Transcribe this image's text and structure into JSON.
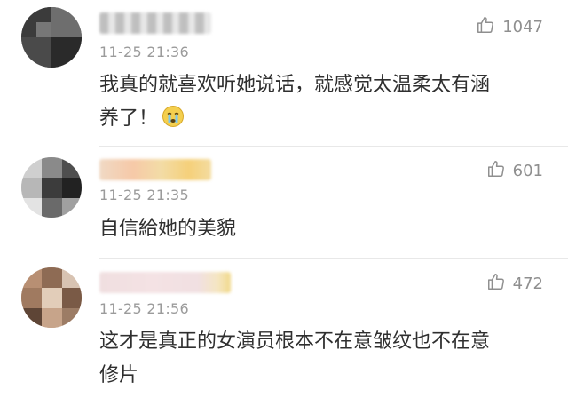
{
  "comments": [
    {
      "time": "11-25 21:36",
      "text_line1": "我真的就喜欢听她说话，就感觉太温柔太有涵",
      "text_line2": "养了！",
      "emoji": "crying-face",
      "likes": "1047"
    },
    {
      "time": "11-25 21:35",
      "text_line1": "自信給她的美貌",
      "likes": "601"
    },
    {
      "time": "11-25 21:56",
      "text_line1": "这才是真正的女演员根本不在意皱纹也不在意",
      "text_line2": "修片",
      "likes": "472"
    }
  ],
  "icons": {
    "like": "thumbs-up-icon"
  },
  "colors": {
    "background": "#ffffff",
    "text": "#2f2f2f",
    "meta": "#9b9b9b",
    "divider": "#e8e8e8"
  }
}
